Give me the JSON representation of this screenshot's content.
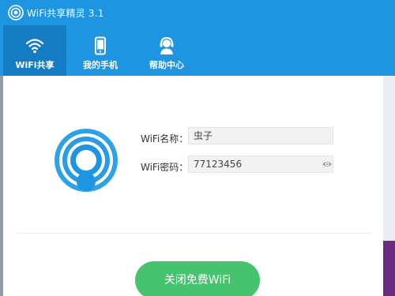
{
  "app": {
    "title": "WiFi共享精灵 3.1"
  },
  "nav": {
    "items": [
      {
        "label": "WiFi共享",
        "icon": "wifi-icon",
        "active": true
      },
      {
        "label": "我的手机",
        "icon": "phone-icon",
        "active": false
      },
      {
        "label": "帮助中心",
        "icon": "support-agent-icon",
        "active": false
      }
    ]
  },
  "form": {
    "name_label": "WiFi名称：",
    "name_value": "虫子",
    "password_label": "WiFi密码：",
    "password_value": "77123456"
  },
  "action": {
    "label": "关闭免费WiFi"
  },
  "colors": {
    "header": "#1e95e0",
    "nav_active": "#147cc3",
    "button": "#46c36e",
    "logo_blue": "#1e95e0"
  }
}
